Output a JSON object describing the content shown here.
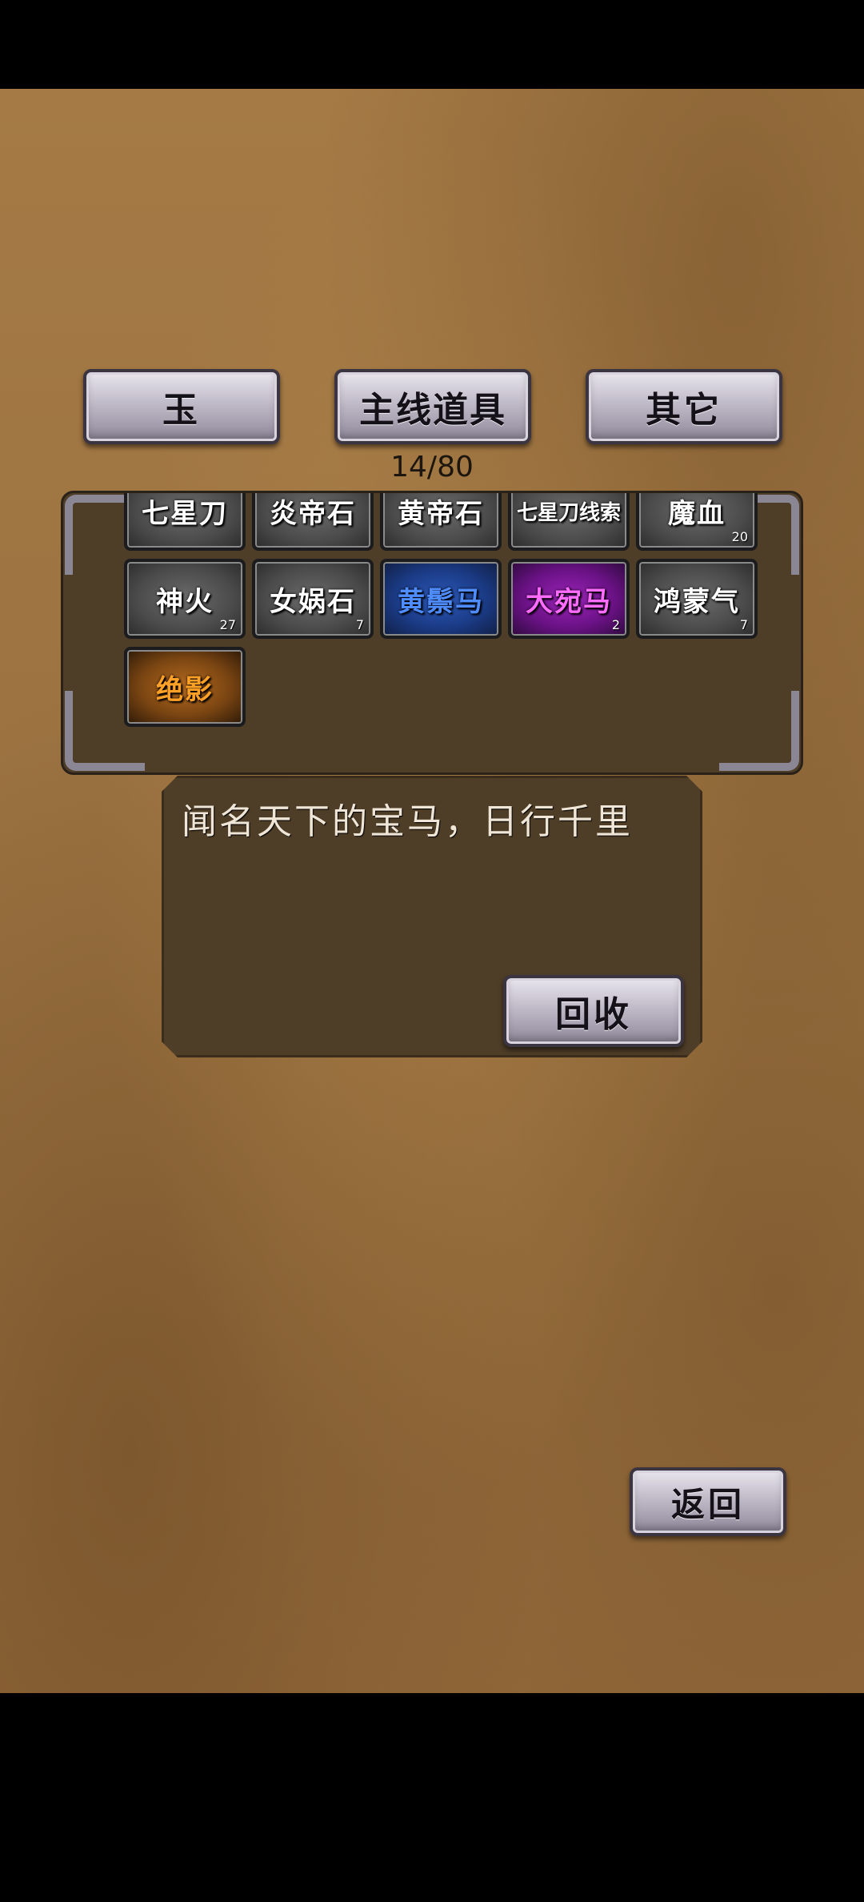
{
  "tabs": [
    {
      "label": "玉"
    },
    {
      "label": "主线道具"
    },
    {
      "label": "其它"
    }
  ],
  "inventory": {
    "count": "14/80",
    "items": [
      {
        "name": "七星刀",
        "qty": "",
        "rarity": "gray"
      },
      {
        "name": "炎帝石",
        "qty": "",
        "rarity": "gray"
      },
      {
        "name": "黄帝石",
        "qty": "",
        "rarity": "gray"
      },
      {
        "name": "七星刀线索",
        "qty": "",
        "rarity": "gray"
      },
      {
        "name": "魔血",
        "qty": "20",
        "rarity": "gray"
      },
      {
        "name": "神火",
        "qty": "27",
        "rarity": "gray"
      },
      {
        "name": "女娲石",
        "qty": "7",
        "rarity": "gray"
      },
      {
        "name": "黄鬃马",
        "qty": "",
        "rarity": "blue"
      },
      {
        "name": "大宛马",
        "qty": "2",
        "rarity": "purple"
      },
      {
        "name": "鸿蒙气",
        "qty": "7",
        "rarity": "gray"
      },
      {
        "name": "绝影",
        "qty": "",
        "rarity": "orange"
      }
    ]
  },
  "description": {
    "text": "闻名天下的宝马，日行千里",
    "recycle_label": "回收"
  },
  "back_label": "返回",
  "colors": {
    "rarity_blue": "#4f8dff",
    "rarity_purple": "#ff6cff",
    "rarity_orange": "#ffa126",
    "panel": "#4e3d27",
    "parchment": "#9a7140"
  }
}
